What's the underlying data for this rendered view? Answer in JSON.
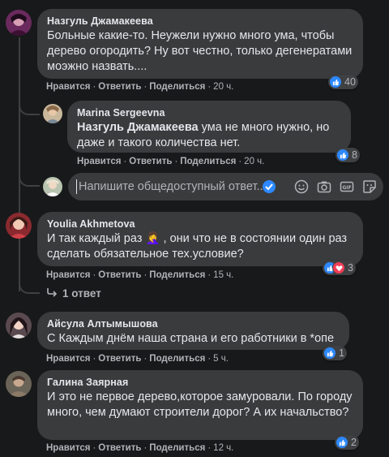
{
  "comments": [
    {
      "author": "Назгуль Джамакеева",
      "text": "Больные какие-то. Неужели нужно много ума, чтобы дерево огородить? Ну вот честно, только дегенератами моэжно назвать....",
      "like": "Нравится",
      "reply": "Ответить",
      "share": "Поделиться",
      "time": "20 ч.",
      "reactions": "40"
    },
    {
      "author": "Marina Sergeevna",
      "mention": "Назгуль Джамакеева",
      "text": " ума не много нужно, но даже и такого количества нет.",
      "like": "Нравится",
      "reply": "Ответить",
      "share": "Поделиться",
      "time": "20 ч.",
      "reactions": "8"
    },
    {
      "author": "Youlia Akhmetova",
      "text": "И так каждый раз 🤦‍♀️ , они что не в состоянии один раз сделать обязательное тех.условие?",
      "like": "Нравится",
      "reply": "Ответить",
      "share": "Поделиться",
      "time": "15 ч.",
      "reactions": "3"
    },
    {
      "author": "Айсула Алтымышова",
      "text": "С Каждым днём наша страна и его работники в *опе",
      "like": "Нравится",
      "reply": "Ответить",
      "share": "Поделиться",
      "time": "5 ч.",
      "reactions": "1"
    },
    {
      "author": "Галина Заярная",
      "text": "И это не первое дерево,которое замуровали. По городу много, чем думают строители дорог? А их начальство?",
      "like": "Нравится",
      "reply": "Ответить",
      "share": "Поделиться",
      "time": "12 ч.",
      "reactions": "2"
    }
  ],
  "reply_box": {
    "placeholder": "Напишите общедоступный ответ..."
  },
  "more_replies": "1 ответ",
  "colors": {
    "background": "#18191a",
    "bubble": "#3a3b3c",
    "like_blue": "#2d88ff",
    "love_red": "#f33e58",
    "secondary_text": "#b0b3b8"
  },
  "icons": [
    "like-reaction-icon",
    "love-reaction-icon",
    "emoji-icon",
    "camera-icon",
    "gif-icon",
    "sticker-icon",
    "reply-arrow-icon"
  ]
}
